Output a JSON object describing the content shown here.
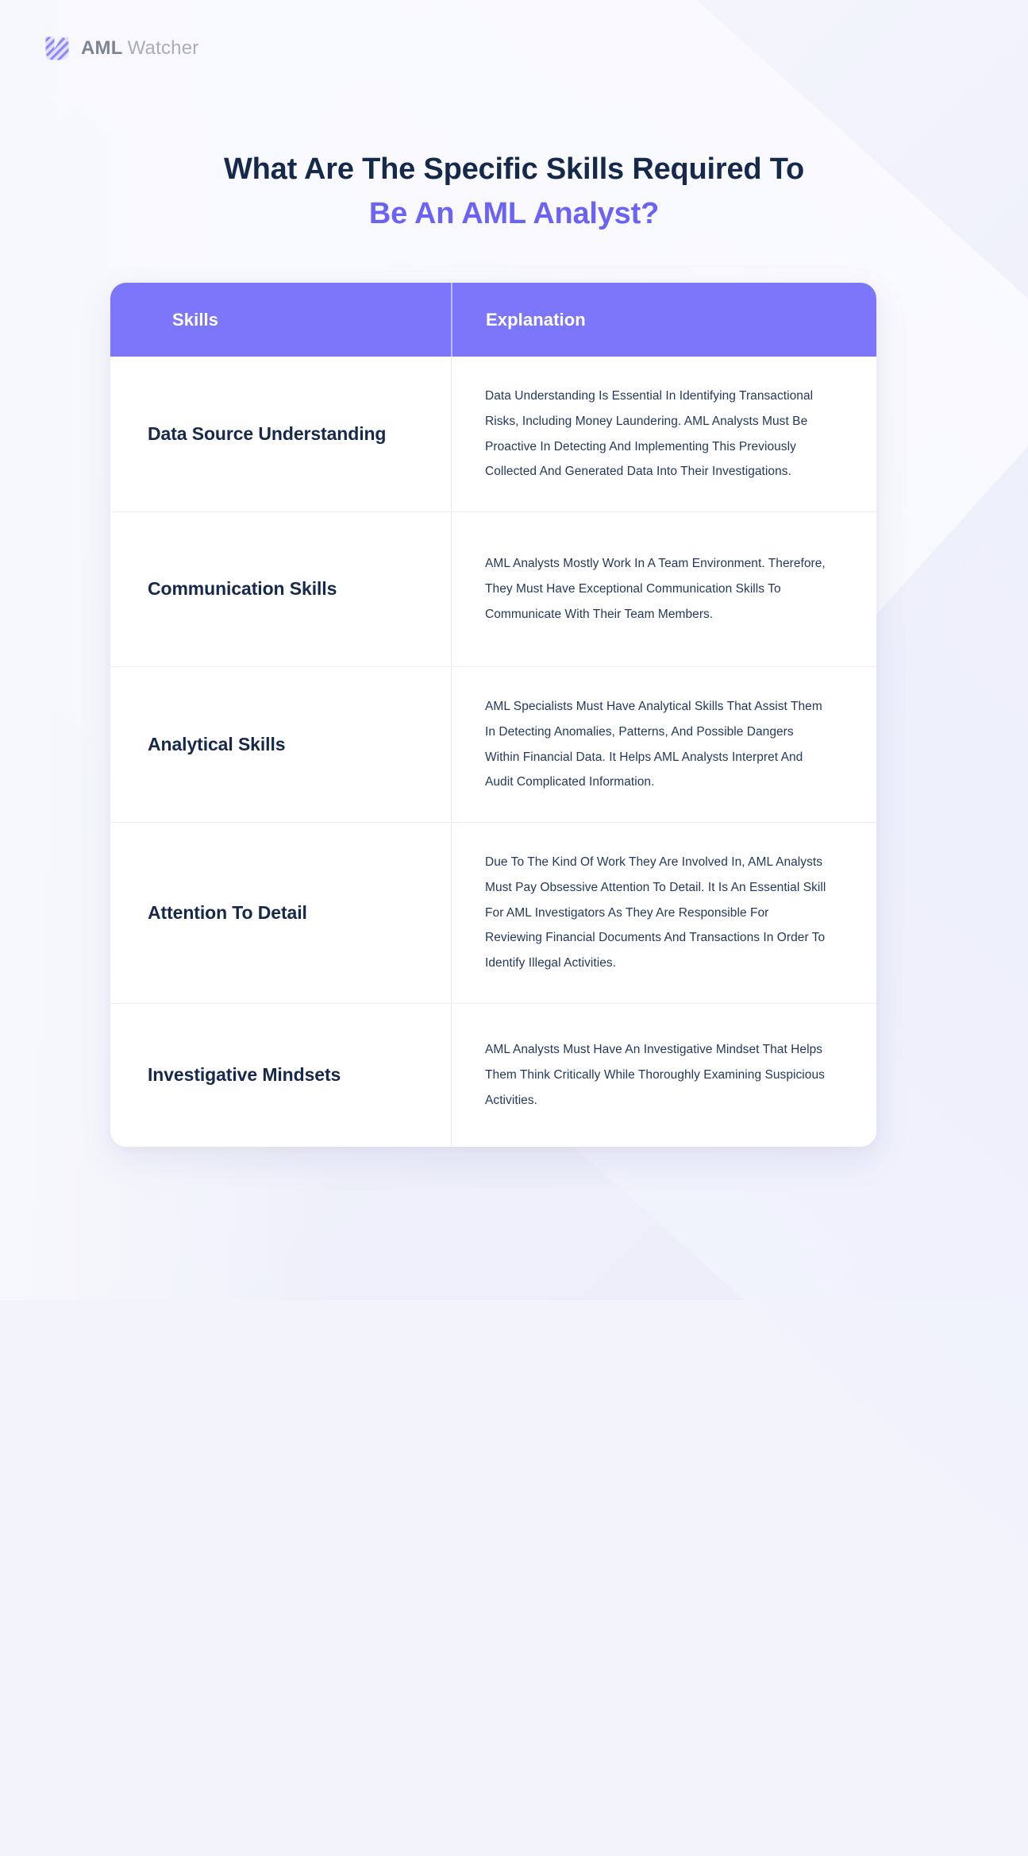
{
  "brand": {
    "logo_icon": "aml-watcher-logo-icon",
    "name_bold": "AML",
    "name_light": "Watcher"
  },
  "heading": {
    "line1": "What Are The Specific Skills Required To",
    "line2": "Be An AML Analyst?"
  },
  "colors": {
    "header_purple": "#7b76fa",
    "heading_dark": "#15294b",
    "heading_accent": "#6c63f5",
    "body_text": "#23395c",
    "page_background": "#f2f3fb"
  },
  "table": {
    "columns": [
      "Skills",
      "Explanation"
    ],
    "rows": [
      {
        "skill": "Data Source Understanding",
        "explanation": "Data Understanding Is Essential In Identifying Transactional Risks, Including Money Laundering. AML Analysts Must Be Proactive In Detecting And Implementing This Previously Collected And Generated Data Into Their Investigations."
      },
      {
        "skill": "Communication Skills",
        "explanation": "AML Analysts Mostly Work In A Team Environment. Therefore, They Must Have Exceptional Communication Skills To Communicate With Their Team Members."
      },
      {
        "skill": "Analytical Skills",
        "explanation": "AML Specialists Must Have Analytical Skills That Assist Them In Detecting Anomalies, Patterns, And Possible Dangers Within Financial Data. It Helps AML Analysts Interpret And Audit Complicated Information."
      },
      {
        "skill": "Attention To Detail",
        "explanation": "Due To The Kind Of Work They Are Involved In, AML Analysts Must Pay Obsessive Attention To Detail. It Is An Essential Skill For AML Investigators As They Are Responsible For Reviewing Financial Documents And Transactions In Order To Identify Illegal Activities."
      },
      {
        "skill": "Investigative Mindsets",
        "explanation": "AML Analysts Must Have An Investigative Mindset That Helps Them Think Critically While Thoroughly Examining Suspicious Activities."
      }
    ]
  }
}
